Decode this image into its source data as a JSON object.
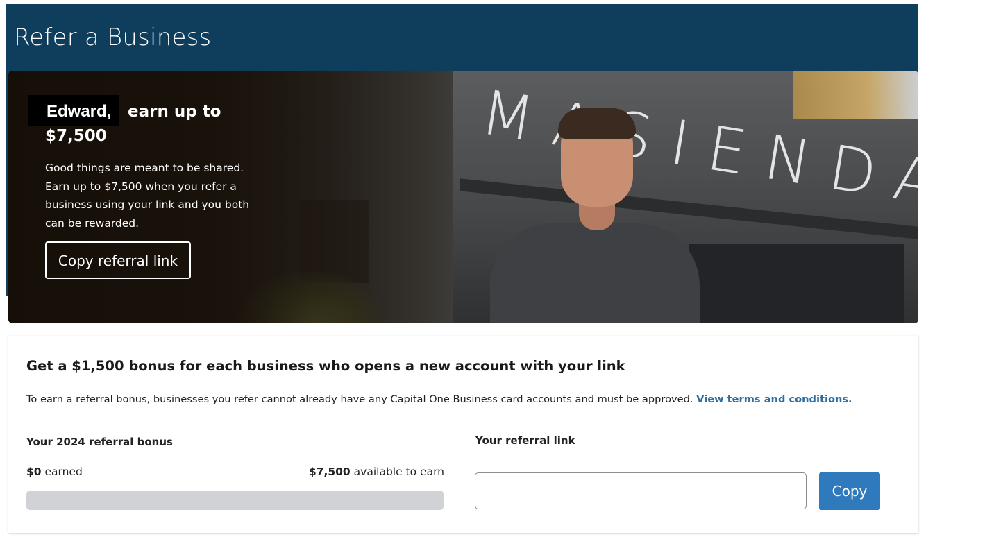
{
  "header": {
    "title": "Refer a Business",
    "background_color": "#0f3d5c"
  },
  "hero": {
    "name": "Edward,",
    "earn_up_to": "earn up to",
    "amount": "$7,500",
    "description": "Good things are meant to be shared. Earn up to $7,500 when you refer a business using your link and you both can be rewarded.",
    "copy_referral_button": "Copy referral link",
    "sign_text": "MASIENDA"
  },
  "referral_card": {
    "title": "Get a $1,500 bonus for each business who opens a new account with your link",
    "description": "To earn a referral bonus, businesses you refer cannot already have any Capital One Business card accounts and must be approved.",
    "terms_link": "View terms and conditions.",
    "bonus": {
      "label": "Your 2024 referral bonus",
      "earned_amount": "$0",
      "earned_suffix": " earned",
      "available_amount": "$7,500",
      "available_suffix": " available to earn",
      "progress_fraction": 0
    },
    "link": {
      "label": "Your referral link",
      "value": "",
      "copy_button": "Copy"
    }
  },
  "colors": {
    "accent": "#2f79bd",
    "link": "#2b6ea3",
    "progress_track": "#d0d2d5"
  }
}
